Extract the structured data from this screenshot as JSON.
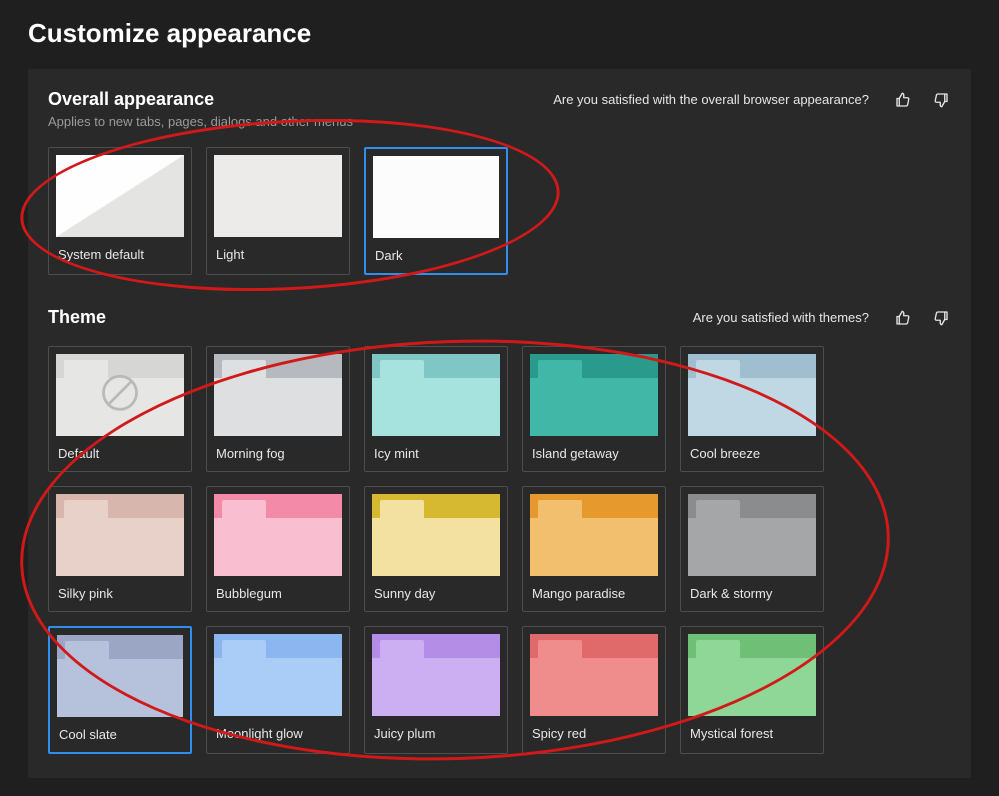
{
  "page_title": "Customize appearance",
  "overall": {
    "title": "Overall appearance",
    "desc": "Applies to new tabs, pages, dialogs and other menus",
    "feedback_q": "Are you satisfied with the overall browser appearance?",
    "options": [
      {
        "id": "system-default",
        "label": "System default",
        "selected": false,
        "kind": "sysdefault"
      },
      {
        "id": "light",
        "label": "Light",
        "selected": false,
        "kind": "light"
      },
      {
        "id": "dark",
        "label": "Dark",
        "selected": true,
        "kind": "dark"
      }
    ]
  },
  "theme": {
    "title": "Theme",
    "feedback_q": "Are you satisfied with themes?",
    "items": [
      {
        "label": "Default",
        "selected": false,
        "topbar": "#d6d6d4",
        "tab": "#e6e6e4",
        "body": "#e6e6e4",
        "no_icon": true
      },
      {
        "label": "Morning fog",
        "selected": false,
        "topbar": "#b6b9bd",
        "tab": "#dddfe1",
        "body": "#dddfe1"
      },
      {
        "label": "Icy mint",
        "selected": false,
        "topbar": "#7fc7c4",
        "tab": "#a6e3de",
        "body": "#a6e3de"
      },
      {
        "label": "Island getaway",
        "selected": false,
        "topbar": "#2a9a8c",
        "tab": "#41b7a7",
        "body": "#41b7a7"
      },
      {
        "label": "Cool breeze",
        "selected": false,
        "topbar": "#9fbfd0",
        "tab": "#bfd8e4",
        "body": "#bfd8e4"
      },
      {
        "label": "Silky pink",
        "selected": false,
        "topbar": "#d7b7ad",
        "tab": "#e7d1c9",
        "body": "#e7d1c9"
      },
      {
        "label": "Bubblegum",
        "selected": false,
        "topbar": "#f28aa8",
        "tab": "#f9bfd0",
        "body": "#f9bfd0"
      },
      {
        "label": "Sunny day",
        "selected": false,
        "topbar": "#d6b931",
        "tab": "#f2e1a0",
        "body": "#f2e1a0"
      },
      {
        "label": "Mango paradise",
        "selected": false,
        "topbar": "#e69a2e",
        "tab": "#f2bf6f",
        "body": "#f2bf6f"
      },
      {
        "label": "Dark & stormy",
        "selected": false,
        "topbar": "#8a8c8e",
        "tab": "#a4a6a8",
        "body": "#a4a6a8"
      },
      {
        "label": "Cool slate",
        "selected": true,
        "topbar": "#9aa6c4",
        "tab": "#b6c1db",
        "body": "#b6c1db"
      },
      {
        "label": "Moonlight glow",
        "selected": false,
        "topbar": "#8bb6ef",
        "tab": "#a9cdf6",
        "body": "#a9cdf6"
      },
      {
        "label": "Juicy plum",
        "selected": false,
        "topbar": "#b48de6",
        "tab": "#ccaef2",
        "body": "#ccaef2"
      },
      {
        "label": "Spicy red",
        "selected": false,
        "topbar": "#e06a6a",
        "tab": "#ef8d8d",
        "body": "#ef8d8d"
      },
      {
        "label": "Mystical forest",
        "selected": false,
        "topbar": "#6fbf77",
        "tab": "#8fd796",
        "body": "#8fd796"
      }
    ]
  }
}
